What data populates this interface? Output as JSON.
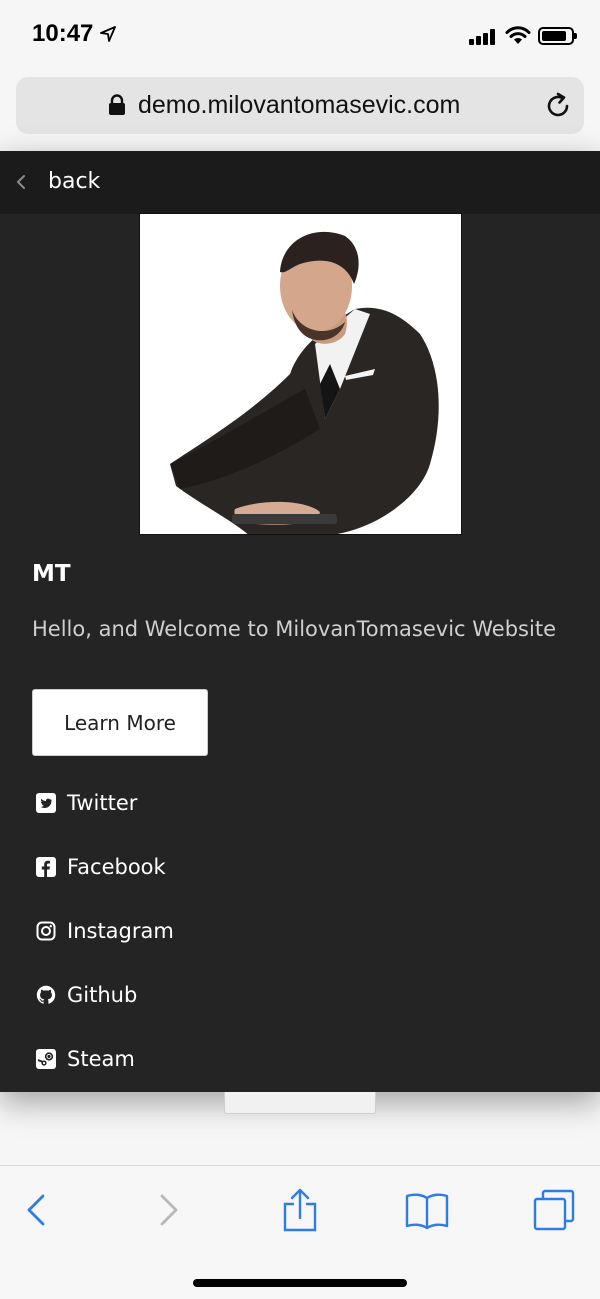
{
  "status": {
    "time": "10:47"
  },
  "browser": {
    "url": "demo.milovantomasevic.com"
  },
  "nav": {
    "back_label": "back"
  },
  "hero": {
    "title": "MT",
    "tagline": "Hello, and Welcome to MilovanTomasevic Website",
    "cta_label": "Learn More"
  },
  "social": [
    {
      "label": "Twitter",
      "icon": "twitter-icon"
    },
    {
      "label": "Facebook",
      "icon": "facebook-icon"
    },
    {
      "label": "Instagram",
      "icon": "instagram-icon"
    },
    {
      "label": "Github",
      "icon": "github-icon"
    },
    {
      "label": "Steam",
      "icon": "steam-icon"
    }
  ],
  "colors": {
    "panel": "#242424",
    "nav_bar": "#1b1b1b",
    "ios_blue": "#2f7ce6",
    "disabled": "#b8b8b8"
  }
}
